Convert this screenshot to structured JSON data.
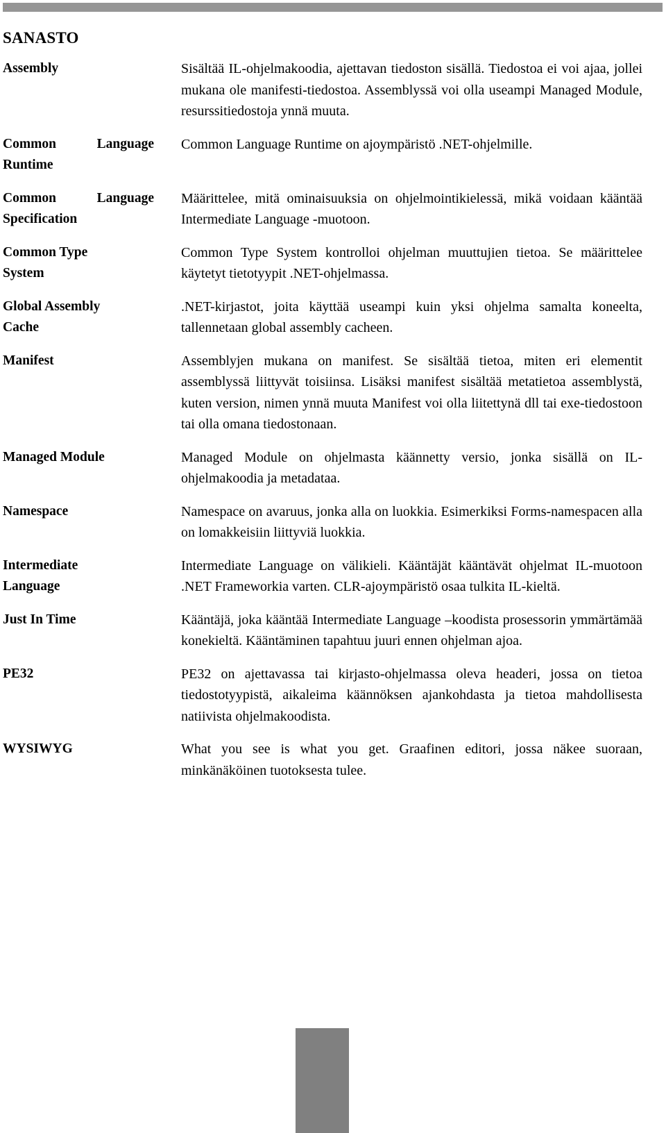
{
  "document": {
    "title": "SANASTO",
    "language": "fi"
  },
  "decorations": {
    "top_rule_color": "#969696",
    "bottom_block_color": "#808080"
  },
  "glossary": {
    "entries": [
      {
        "term": "Assembly",
        "term_lines": [
          "Assembly"
        ],
        "definition": "Sisältää IL-ohjelmakoodia, ajettavan tiedoston sisällä. Tiedostoa ei voi ajaa, jollei mukana ole manifesti-tiedostoa. Assemblyssä voi olla useampi Managed Module, resurssitiedostoja ynnä muuta."
      },
      {
        "term": "Common Language Runtime",
        "term_lines": [
          "Common Language",
          "Runtime"
        ],
        "definition": "Common Language Runtime on ajoympäristö .NET-ohjelmille."
      },
      {
        "term": "Common Language Specification",
        "term_lines": [
          "Common Language",
          "Specification"
        ],
        "definition": "Määrittelee, mitä ominaisuuksia on ohjelmointikielessä, mikä voidaan kääntää Intermediate Language -muotoon."
      },
      {
        "term": "Common Type System",
        "term_lines": [
          "Common Type",
          "System"
        ],
        "definition": "Common Type System kontrolloi ohjelman muuttujien tietoa. Se määrittelee käytetyt tietotyypit .NET-ohjelmassa."
      },
      {
        "term": "Global Assembly Cache",
        "term_lines": [
          "Global Assembly",
          "Cache"
        ],
        "definition": ".NET-kirjastot, joita käyttää useampi kuin yksi ohjelma samalta koneelta, tallennetaan global assembly cacheen."
      },
      {
        "term": "Manifest",
        "term_lines": [
          "Manifest"
        ],
        "definition": "Assemblyjen mukana on manifest. Se sisältää tietoa, miten eri elementit assemblyssä liittyvät toisiinsa. Lisäksi manifest sisältää metatietoa assemblystä, kuten version, nimen ynnä muuta Manifest voi olla liitettynä dll tai exe-tiedostoon tai olla omana tiedostonaan."
      },
      {
        "term": "Managed Module",
        "term_lines": [
          "Managed Module"
        ],
        "definition": "Managed Module on ohjelmasta käännetty versio, jonka sisällä on IL-ohjelmakoodia ja metadataa."
      },
      {
        "term": "Namespace",
        "term_lines": [
          "Namespace"
        ],
        "definition": "Namespace on avaruus, jonka alla on luokkia. Esimerkiksi Forms-namespacen alla on lomakkeisiin liittyviä luokkia."
      },
      {
        "term": "Intermediate Language",
        "term_lines": [
          "Intermediate",
          "Language"
        ],
        "definition": "Intermediate Language on välikieli. Kääntäjät kääntävät ohjelmat IL-muotoon .NET Frameworkia varten. CLR-ajoympäristö osaa tulkita IL-kieltä."
      },
      {
        "term": "Just In Time",
        "term_lines": [
          "Just In Time"
        ],
        "definition": "Kääntäjä, joka kääntää Intermediate Language –koodista prosessorin ymmärtämää konekieltä. Kääntäminen tapahtuu juuri ennen ohjelman ajoa."
      },
      {
        "term": "PE32",
        "term_lines": [
          "PE32"
        ],
        "definition": "PE32 on ajettavassa tai kirjasto-ohjelmassa oleva headeri, jossa on tietoa tiedostotyypistä, aikaleima käännöksen ajankohdasta ja tietoa mahdollisesta natiivista ohjelmakoodista."
      },
      {
        "term": "WYSIWYG",
        "term_lines": [
          "WYSIWYG"
        ],
        "definition": "What you see is what you get. Graafinen editori, jossa näkee suoraan, minkänäköinen tuotoksesta tulee."
      }
    ]
  }
}
